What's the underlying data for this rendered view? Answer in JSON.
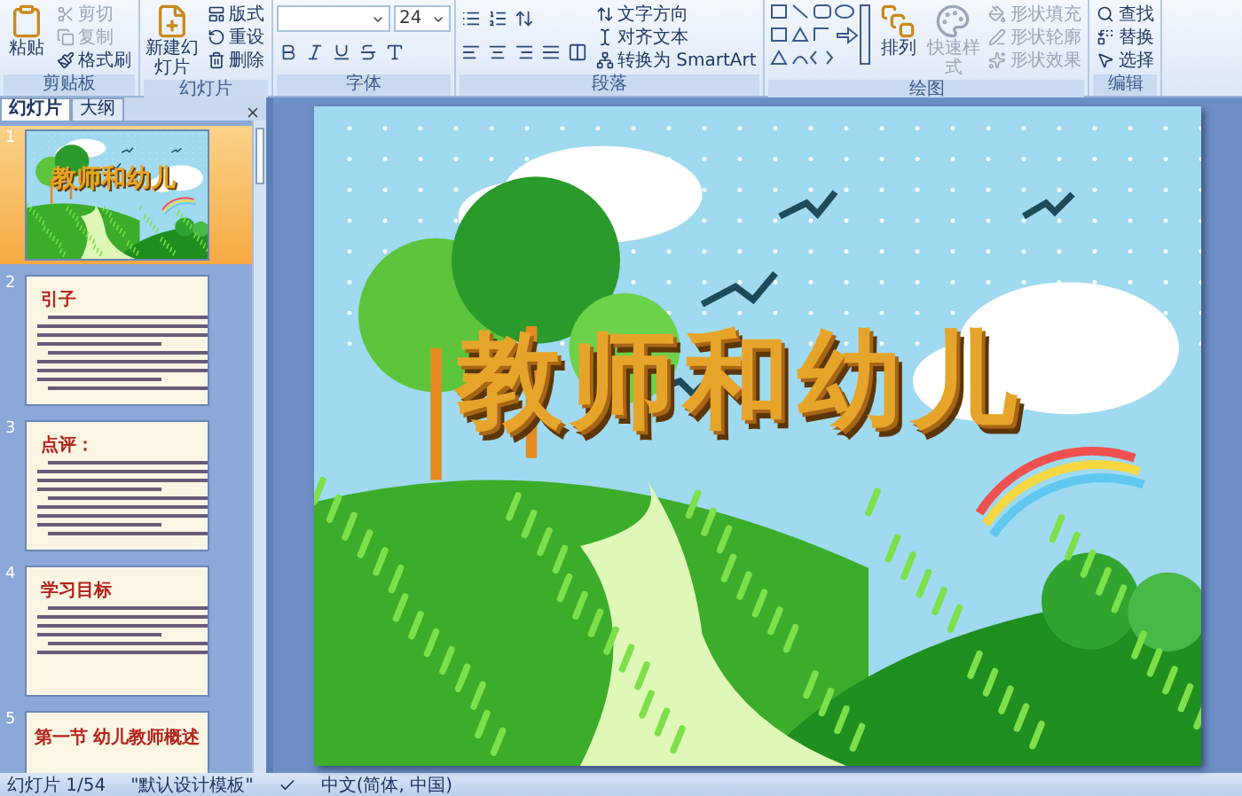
{
  "ribbon": {
    "groups": [
      {
        "label": "剪贴板",
        "columns": [
          {
            "kind": "large",
            "label": "粘贴",
            "disabled": false
          },
          {
            "kind": "stack",
            "items": [
              {
                "label": "剪切",
                "disabled": true
              },
              {
                "label": "复制",
                "disabled": true
              },
              {
                "label": "格式刷",
                "disabled": false
              }
            ]
          }
        ]
      },
      {
        "label": "幻灯片",
        "columns": [
          {
            "kind": "large",
            "label": "新建幻灯片",
            "disabled": false
          },
          {
            "kind": "stack",
            "items": [
              {
                "label": "版式",
                "disabled": false
              },
              {
                "label": "重设",
                "disabled": false
              },
              {
                "label": "删除",
                "disabled": false
              }
            ]
          }
        ]
      },
      {
        "label": "字体",
        "columns": [
          {
            "kind": "font",
            "font_size": "24"
          }
        ]
      },
      {
        "label": "段落",
        "columns": [
          {
            "kind": "paragraph"
          },
          {
            "kind": "stack",
            "items": [
              {
                "label": "文字方向",
                "disabled": false
              },
              {
                "label": "对齐文本",
                "disabled": false
              },
              {
                "label": "转换为 SmartArt",
                "disabled": false
              }
            ]
          }
        ]
      },
      {
        "label": "绘图",
        "columns": [
          {
            "kind": "shapes"
          },
          {
            "kind": "large",
            "label": "排列",
            "disabled": false
          },
          {
            "kind": "large",
            "label": "快速样式",
            "disabled": true
          },
          {
            "kind": "stack",
            "items": [
              {
                "label": "形状填充",
                "disabled": true
              },
              {
                "label": "形状轮廓",
                "disabled": true
              },
              {
                "label": "形状效果",
                "disabled": true
              }
            ]
          }
        ]
      },
      {
        "label": "编辑",
        "columns": [
          {
            "kind": "stack",
            "items": [
              {
                "label": "查找",
                "disabled": false
              },
              {
                "label": "替换",
                "disabled": false
              },
              {
                "label": "选择",
                "disabled": false
              }
            ]
          }
        ]
      }
    ]
  },
  "panel_tabs": [
    {
      "label": "幻灯片",
      "selected": true
    },
    {
      "label": "大纲",
      "selected": false
    }
  ],
  "thumbnails": [
    {
      "number": "1",
      "kind": "cover",
      "title": "教师和幼儿",
      "selected": true
    },
    {
      "number": "2",
      "kind": "text",
      "title": "引子",
      "selected": false
    },
    {
      "number": "3",
      "kind": "text",
      "title": "点评：",
      "selected": false
    },
    {
      "number": "4",
      "kind": "bullets",
      "title": "学习目标",
      "selected": false
    },
    {
      "number": "5",
      "kind": "heading",
      "title": "第一节  幼儿教师概述",
      "selected": false
    }
  ],
  "slide": {
    "title": "教师和幼儿"
  },
  "status_bar": {
    "slide_counter": "幻灯片 1/54",
    "theme": "\"默认设计模板\"",
    "language": "中文(简体, 中国)"
  }
}
